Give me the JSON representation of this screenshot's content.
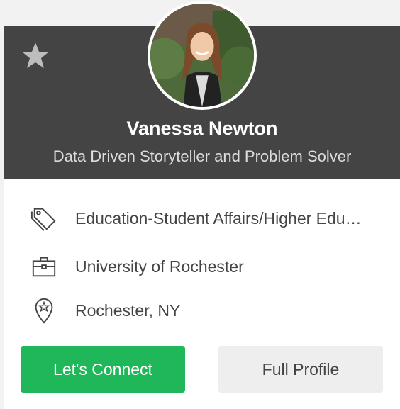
{
  "profile": {
    "name": "Vanessa Newton",
    "headline": "Data Driven Storyteller and Problem Solver",
    "avatar_icon": "profile-photo"
  },
  "favorite": {
    "icon": "star-icon",
    "color": "#bdbdbd"
  },
  "details": {
    "industry": "Education-Student Affairs/Higher Edu…",
    "employer": "University of Rochester",
    "location": "Rochester, NY"
  },
  "actions": {
    "connect_label": "Let's Connect",
    "full_profile_label": "Full Profile"
  },
  "colors": {
    "header_bg": "#444444",
    "primary": "#20b75a",
    "secondary_bg": "#eeeeee"
  }
}
